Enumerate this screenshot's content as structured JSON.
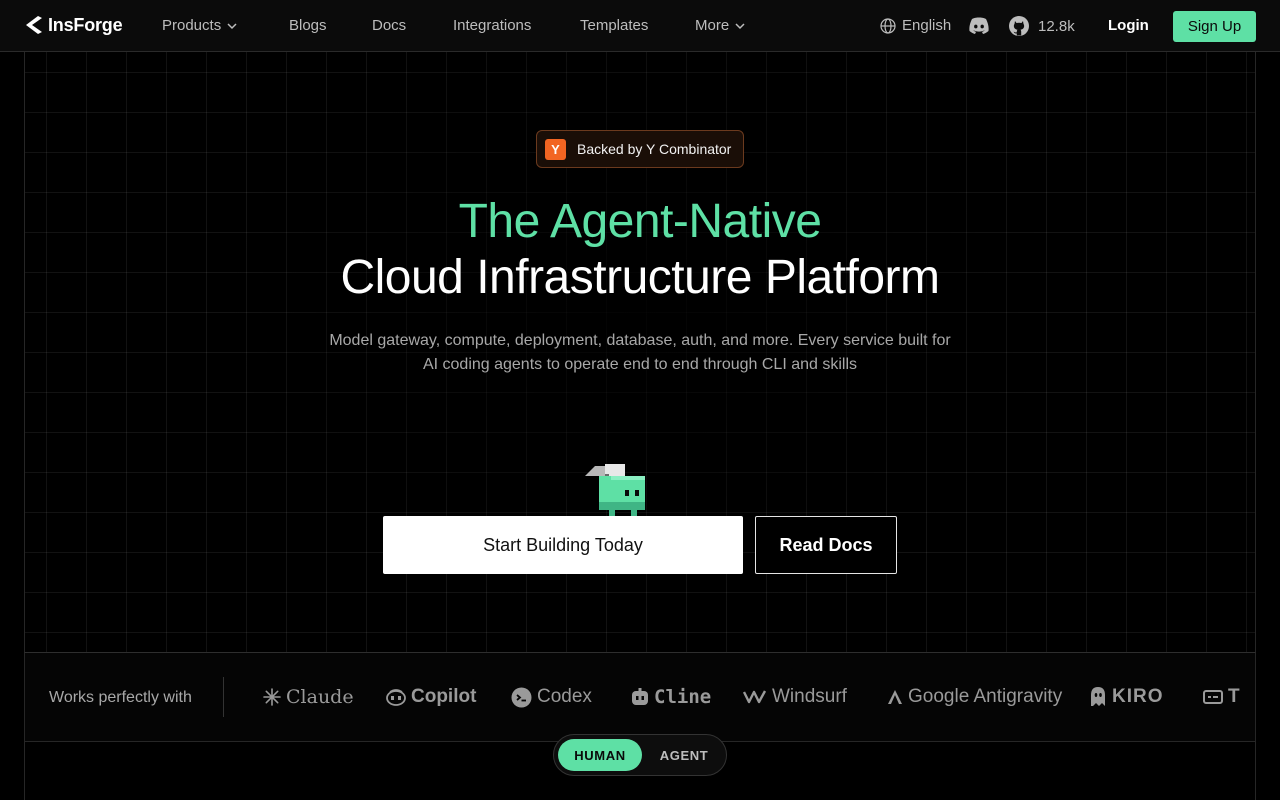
{
  "nav": {
    "brand": "InsForge",
    "links": [
      "Products",
      "Blogs",
      "Docs",
      "Integrations",
      "Templates",
      "More"
    ],
    "language": "English",
    "github_stars": "12.8k",
    "login": "Login",
    "signup": "Sign Up"
  },
  "hero": {
    "badge_logo": "Y",
    "badge_text": "Backed by Y Combinator",
    "title_line1": "The Agent-Native",
    "title_line2": "Cloud Infrastructure Platform",
    "subtitle_line1": "Model gateway, compute, deployment, database, auth, and more. Every service built for",
    "subtitle_line2": "AI coding agents to operate end to end through CLI and skills",
    "primary_cta": "Start Building Today",
    "secondary_cta": "Read Docs"
  },
  "works_with": {
    "label": "Works perfectly with",
    "partners": [
      "Claude",
      "Copilot",
      "Codex",
      "Cline",
      "Windsurf",
      "Google Antigravity",
      "KIRO",
      "T"
    ]
  },
  "mode_toggle": {
    "human": "HUMAN",
    "agent": "AGENT"
  },
  "colors": {
    "accent": "#5ee0a5",
    "yc_orange": "#f26522",
    "background": "#000000"
  }
}
